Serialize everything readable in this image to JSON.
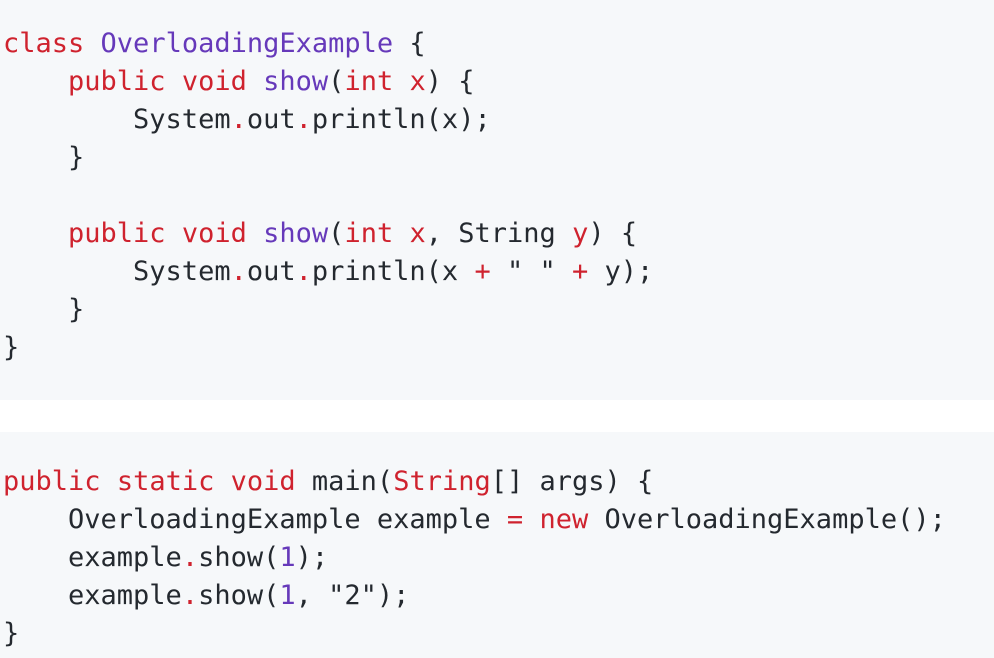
{
  "colors": {
    "background": "#ffffff",
    "code_background": "#f6f8fa",
    "keyword": "#cf222e",
    "function": "#6639ba",
    "text": "#24292f"
  },
  "code_blocks": [
    {
      "lines": [
        [
          {
            "t": "class",
            "k": "kw"
          },
          {
            "t": " ",
            "k": "plain"
          },
          {
            "t": "OverloadingExample",
            "k": "fn"
          },
          {
            "t": " {",
            "k": "plain"
          }
        ],
        [
          {
            "t": "    ",
            "k": "plain"
          },
          {
            "t": "public",
            "k": "kw"
          },
          {
            "t": " ",
            "k": "plain"
          },
          {
            "t": "void",
            "k": "kw"
          },
          {
            "t": " ",
            "k": "plain"
          },
          {
            "t": "show",
            "k": "fn"
          },
          {
            "t": "(",
            "k": "plain"
          },
          {
            "t": "int",
            "k": "kw"
          },
          {
            "t": " ",
            "k": "plain"
          },
          {
            "t": "x",
            "k": "param"
          },
          {
            "t": ") {",
            "k": "plain"
          }
        ],
        [
          {
            "t": "        System",
            "k": "plain"
          },
          {
            "t": ".",
            "k": "dot"
          },
          {
            "t": "out",
            "k": "plain"
          },
          {
            "t": ".",
            "k": "dot"
          },
          {
            "t": "println(x);",
            "k": "plain"
          }
        ],
        [
          {
            "t": "    }",
            "k": "plain"
          }
        ],
        [],
        [
          {
            "t": "    ",
            "k": "plain"
          },
          {
            "t": "public",
            "k": "kw"
          },
          {
            "t": " ",
            "k": "plain"
          },
          {
            "t": "void",
            "k": "kw"
          },
          {
            "t": " ",
            "k": "plain"
          },
          {
            "t": "show",
            "k": "fn"
          },
          {
            "t": "(",
            "k": "plain"
          },
          {
            "t": "int",
            "k": "kw"
          },
          {
            "t": " ",
            "k": "plain"
          },
          {
            "t": "x",
            "k": "param"
          },
          {
            "t": ", String ",
            "k": "plain"
          },
          {
            "t": "y",
            "k": "param"
          },
          {
            "t": ") {",
            "k": "plain"
          }
        ],
        [
          {
            "t": "        System",
            "k": "plain"
          },
          {
            "t": ".",
            "k": "dot"
          },
          {
            "t": "out",
            "k": "plain"
          },
          {
            "t": ".",
            "k": "dot"
          },
          {
            "t": "println(x ",
            "k": "plain"
          },
          {
            "t": "+",
            "k": "op"
          },
          {
            "t": " \" \" ",
            "k": "str"
          },
          {
            "t": "+",
            "k": "op"
          },
          {
            "t": " y);",
            "k": "plain"
          }
        ],
        [
          {
            "t": "    }",
            "k": "plain"
          }
        ],
        [
          {
            "t": "}",
            "k": "plain"
          }
        ]
      ]
    },
    {
      "lines": [
        [
          {
            "t": "public",
            "k": "kw"
          },
          {
            "t": " ",
            "k": "plain"
          },
          {
            "t": "static",
            "k": "kw"
          },
          {
            "t": " ",
            "k": "plain"
          },
          {
            "t": "void",
            "k": "kw"
          },
          {
            "t": " main(",
            "k": "plain"
          },
          {
            "t": "String",
            "k": "type"
          },
          {
            "t": "[] args) {",
            "k": "plain"
          }
        ],
        [
          {
            "t": "    OverloadingExample example ",
            "k": "plain"
          },
          {
            "t": "=",
            "k": "op"
          },
          {
            "t": " ",
            "k": "plain"
          },
          {
            "t": "new",
            "k": "kw"
          },
          {
            "t": " OverloadingExample();",
            "k": "plain"
          }
        ],
        [
          {
            "t": "    example",
            "k": "plain"
          },
          {
            "t": ".",
            "k": "dot"
          },
          {
            "t": "show(",
            "k": "plain"
          },
          {
            "t": "1",
            "k": "num"
          },
          {
            "t": ");",
            "k": "plain"
          }
        ],
        [
          {
            "t": "    example",
            "k": "plain"
          },
          {
            "t": ".",
            "k": "dot"
          },
          {
            "t": "show(",
            "k": "plain"
          },
          {
            "t": "1",
            "k": "num"
          },
          {
            "t": ", \"2\");",
            "k": "plain"
          }
        ],
        [
          {
            "t": "}",
            "k": "plain"
          }
        ]
      ]
    }
  ]
}
